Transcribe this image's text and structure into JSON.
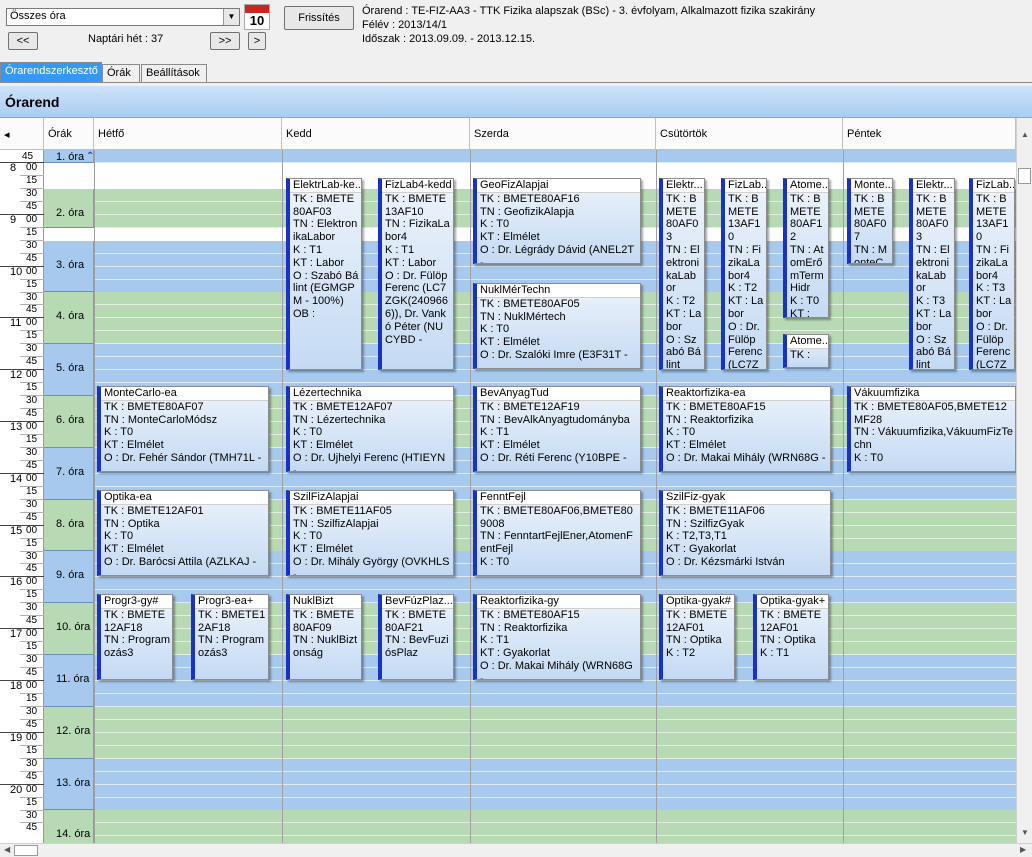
{
  "toolbar": {
    "combo_value": "Összes óra",
    "calendar_day": "10",
    "refresh_label": "Frissítés",
    "prev_label": "<<",
    "next_label": ">>",
    "next_one_label": ">",
    "week_label": "Naptári hét : 37"
  },
  "info": {
    "line1": "Órarend : TE-FIZ-AA3 - TTK Fizika alapszak (BSc) - 3. évfolyam, Alkalmazott fizika szakirány",
    "line2": "Félév : 2013/14/1",
    "line3": "Időszak : 2013.09.09. - 2013.12.15."
  },
  "tabs": [
    "Órarendszerkesztő",
    "Órák",
    "Beállítások"
  ],
  "title": "Órarend",
  "header": {
    "orak": "Órák",
    "days": [
      "Hétfő",
      "Kedd",
      "Szerda",
      "Csütörtök",
      "Péntek"
    ]
  },
  "hours": [
    "8",
    "9",
    "10",
    "11",
    "12",
    "13",
    "14",
    "15",
    "16",
    "17",
    "18",
    "19",
    "20"
  ],
  "minutes": [
    "15",
    "30",
    "45"
  ],
  "first_minute": "45",
  "hour_suffix": "00",
  "periods": [
    "1. óra",
    "2. óra",
    "3. óra",
    "4. óra",
    "5. óra",
    "6. óra",
    "7. óra",
    "8. óra",
    "9. óra",
    "10. óra",
    "11. óra",
    "12. óra",
    "13. óra",
    "14. óra"
  ],
  "events": [
    {
      "title": "ElektrLab-ke...",
      "body": "TK : BMETE80AF03\nTN : ElektronikaLabor\nK : T1\nKT : Labor\nO : Szabó Bálint (EGMGPM - 100%)\nOB :"
    },
    {
      "title": "FizLab4-kedd",
      "body": "TK : BMETE13AF10\nTN : FizikaLabor4\nK : T1\nKT : Labor\nO : Dr. Fülöp Ferenc (LC7ZGK(2409666)), Dr. Vankó Péter (NUCYBD -"
    },
    {
      "title": "GeoFizAlapjai",
      "body": "TK : BMETE80AF16\nTN : GeofizikAlapja\nK : T0\nKT : Elmélet\nO : Dr. Légrády Dávid (ANEL2T -"
    },
    {
      "title": "NuklMérTechn",
      "body": "TK : BMETE80AF05\nTN : NuklMértech\nK : T0\nKT : Elmélet\nO : Dr. Szalóki Imre (E3F31T -"
    },
    {
      "title": "Elektr...",
      "body": "TK : BMETE80AF03\nTN : ElektronikaLabor\nK : T2\nKT : Labor\nO : Szabó Bálint"
    },
    {
      "title": "FizLab...",
      "body": "TK : BMETE13AF10\nTN : FizikaLabor4\nK : T2\nKT : Labor\nO : Dr. Fülöp Ferenc (LC7ZG"
    },
    {
      "title": "Atome...",
      "body": "TK : BMETE80AF12\nTN : AtomErőmTermHidr\nK : T0\nKT :"
    },
    {
      "title": "Atome...",
      "body": "TK :"
    },
    {
      "title": "Monte...",
      "body": "TK : BMETE80AF07\nTN : MonteC"
    },
    {
      "title": "Elektr...",
      "body": "TK : BMETE80AF03\nTN : ElektronikaLabor\nK : T3\nKT : Labor\nO : Szabó Bálint"
    },
    {
      "title": "FizLab...",
      "body": "TK : BMETE13AF10\nTN : FizikaLabor4\nK : T3\nKT : Labor\nO : Dr. Fülöp Ferenc (LC7ZG"
    },
    {
      "title": "MonteCarlo-ea",
      "body": "TK : BMETE80AF07\nTN : MonteCarloMódsz\nK : T0\nKT : Elmélet\nO : Dr. Fehér Sándor (TMH71L -"
    },
    {
      "title": "Lézertechnika",
      "body": "TK : BMETE12AF07\nTN : Lézertechnika\nK : T0\nKT : Elmélet\nO : Dr. Ujhelyi Ferenc (HTIEYN -"
    },
    {
      "title": "BevAnyagTud",
      "body": "TK : BMETE12AF19\nTN : BevAlkAnyagtudományba\nK : T1\nKT : Elmélet\nO : Dr. Réti Ferenc (Y10BPE -"
    },
    {
      "title": "Reaktorfizika-ea",
      "body": "TK : BMETE80AF15\nTN : Reaktorfizika\nK : T0\nKT : Elmélet\nO : Dr. Makai Mihály (WRN68G -"
    },
    {
      "title": "Vákuumfizika",
      "body": "TK : BMETE80AF05,BMETE12MF28\nTN : Vákuumfizika,VákuumFizTechn\nK : T0"
    },
    {
      "title": "Optika-ea",
      "body": "TK : BMETE12AF01\nTN : Optika\nK : T0\nKT : Elmélet\nO : Dr. Barócsi Attila (AZLKAJ -"
    },
    {
      "title": "SzilFizAlapjai",
      "body": "TK : BMETE11AF05\nTN : SzilfizAlapjai\nK : T0\nKT : Elmélet\nO : Dr. Mihály György (OVKHLS -"
    },
    {
      "title": "FenntFejl",
      "body": "TK : BMETE80AF06,BMETE809008\nTN : FenntartFejlEner,AtomenFentFejl\nK : T0"
    },
    {
      "title": "SzilFiz-gyak",
      "body": "TK : BMETE11AF06\nTN : SzilfizGyak\nK : T2,T3,T1\nKT : Gyakorlat\nO : Dr. Kézsmárki István"
    },
    {
      "title": "Progr3-gy#",
      "body": "TK : BMETE12AF18\nTN : Programozás3"
    },
    {
      "title": "Progr3-ea+",
      "body": "TK : BMETE12AF18\nTN : Programozás3"
    },
    {
      "title": "NuklBizt",
      "body": "TK : BMETE80AF09\nTN : NuklBiztonság"
    },
    {
      "title": "BevFúzPlaz...",
      "body": "TK : BMETE80AF21\nTN : BevFuziósPlaz"
    },
    {
      "title": "Reaktorfizika-gy",
      "body": "TK : BMETE80AF15\nTN : Reaktorfizika\nK : T1\nKT : Gyakorlat\nO : Dr. Makai Mihály (WRN68G -"
    },
    {
      "title": "Optika-gyak#",
      "body": "TK : BMETE12AF01\nTN : Optika\nK : T2"
    },
    {
      "title": "Optika-gyak+",
      "body": "TK : BMETE12AF01\nTN : Optika\nK : T1"
    }
  ]
}
